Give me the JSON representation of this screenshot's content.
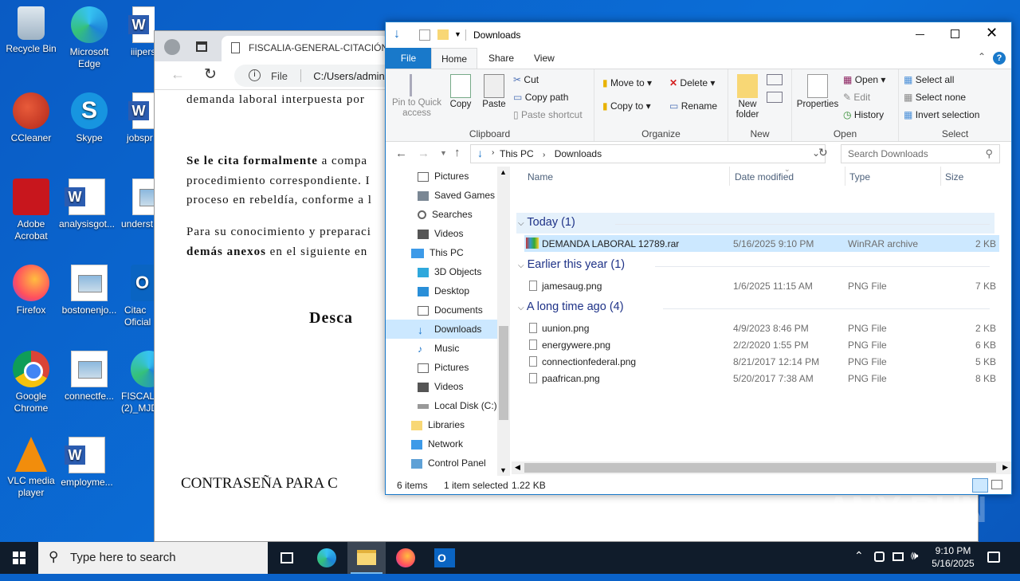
{
  "desktop": {
    "icons": [
      {
        "label": "Recycle Bin",
        "icon": "recycle-bin-icon"
      },
      {
        "label": "Microsoft Edge",
        "icon": "edge-icon"
      },
      {
        "label": "iiipers",
        "icon": "word-icon"
      },
      {
        "label": "CCleaner",
        "icon": "ccleaner-icon"
      },
      {
        "label": "Skype",
        "icon": "skype-icon"
      },
      {
        "label": "jobspr",
        "icon": "word-icon"
      },
      {
        "label": "Adobe Acrobat",
        "icon": "acrobat-icon"
      },
      {
        "label": "analysisgot...",
        "icon": "word-icon"
      },
      {
        "label": "underst",
        "icon": "image-icon"
      },
      {
        "label": "Firefox",
        "icon": "firefox-icon"
      },
      {
        "label": "bostonenjo...",
        "icon": "image-icon"
      },
      {
        "label": "Citac Oficial",
        "icon": "outlook-icon"
      },
      {
        "label": "Google Chrome",
        "icon": "chrome-icon"
      },
      {
        "label": "connectfe...",
        "icon": "image-icon"
      },
      {
        "label": "FISCALI (2)_MJD",
        "icon": "edge-icon"
      },
      {
        "label": "VLC media player",
        "icon": "vlc-icon"
      },
      {
        "label": "employme...",
        "icon": "word-icon"
      }
    ]
  },
  "browser": {
    "tab_title": "FISCALIA-GENERAL-CITACIÓN-F",
    "url_prefix": "File",
    "url": "C:/Users/admin/D",
    "doc": {
      "line1": "demanda laboral interpuesta por",
      "p2_bold": "Se le cita formalmente",
      "p2_rest": " a compa",
      "p2_line2": "procedimiento correspondiente. I",
      "p2_line3": "proceso en rebeldía, conforme a l",
      "p3_line1": "Para su conocimiento y preparaci",
      "p3_bold": "demás anexos",
      "p3_rest": " en el siguiente en",
      "heading": "Desca",
      "footer": "CONTRASEÑA PARA C"
    }
  },
  "explorer": {
    "title": "Downloads",
    "tabs": [
      "File",
      "Home",
      "Share",
      "View"
    ],
    "ribbon": {
      "clipboard": {
        "pin": "Pin to Quick access",
        "copy": "Copy",
        "paste": "Paste",
        "cut": "Cut",
        "copy_path": "Copy path",
        "paste_shortcut": "Paste shortcut",
        "label": "Clipboard"
      },
      "organize": {
        "move_to": "Move to",
        "copy_to": "Copy to",
        "delete": "Delete",
        "rename": "Rename",
        "label": "Organize"
      },
      "new": {
        "new_folder": "New folder",
        "label": "New"
      },
      "open": {
        "properties": "Properties",
        "open": "Open",
        "edit": "Edit",
        "history": "History",
        "label": "Open"
      },
      "select": {
        "select_all": "Select all",
        "select_none": "Select none",
        "invert": "Invert selection",
        "label": "Select"
      }
    },
    "path": [
      "This PC",
      "Downloads"
    ],
    "search_placeholder": "Search Downloads",
    "nav": [
      "Pictures",
      "Saved Games",
      "Searches",
      "Videos",
      "This PC",
      "3D Objects",
      "Desktop",
      "Documents",
      "Downloads",
      "Music",
      "Pictures",
      "Videos",
      "Local Disk (C:)",
      "Libraries",
      "Network",
      "Control Panel"
    ],
    "columns": [
      "Name",
      "Date modified",
      "Type",
      "Size"
    ],
    "groups": [
      {
        "header": "Today (1)",
        "files": [
          {
            "name": "DEMANDA LABORAL 12789.rar",
            "date": "5/16/2025 9:10 PM",
            "type": "WinRAR archive",
            "size": "2 KB"
          }
        ]
      },
      {
        "header": "Earlier this year (1)",
        "files": [
          {
            "name": "jamesaug.png",
            "date": "1/6/2025 11:15 AM",
            "type": "PNG File",
            "size": "7 KB"
          }
        ]
      },
      {
        "header": "A long time ago (4)",
        "files": [
          {
            "name": "uunion.png",
            "date": "4/9/2023 8:46 PM",
            "type": "PNG File",
            "size": "2 KB"
          },
          {
            "name": "energywere.png",
            "date": "2/2/2020 1:55 PM",
            "type": "PNG File",
            "size": "6 KB"
          },
          {
            "name": "connectionfederal.png",
            "date": "8/21/2017 12:14 PM",
            "type": "PNG File",
            "size": "5 KB"
          },
          {
            "name": "paafrican.png",
            "date": "5/20/2017 7:38 AM",
            "type": "PNG File",
            "size": "8 KB"
          }
        ]
      }
    ],
    "status": {
      "items": "6 items",
      "selected": "1 item selected",
      "size": "1.22 KB"
    }
  },
  "taskbar": {
    "search_placeholder": "Type here to search",
    "time": "9:10 PM",
    "date": "5/16/2025"
  },
  "watermark": "ANY RUN"
}
